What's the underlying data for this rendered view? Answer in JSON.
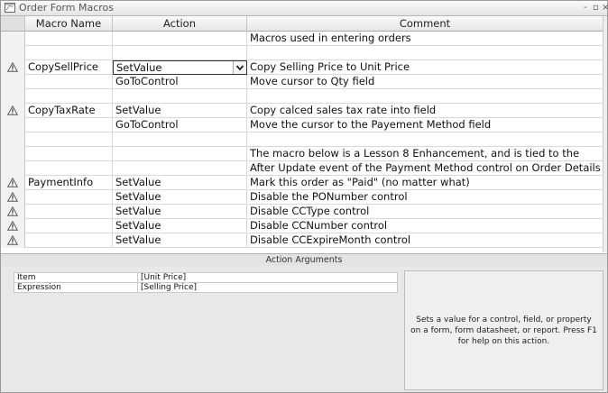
{
  "window": {
    "title": "Order Form Macros",
    "controls": {
      "minimize": "-",
      "restore": "▫",
      "close": "×"
    }
  },
  "columns": {
    "name": "Macro Name",
    "action": "Action",
    "comment": "Comment"
  },
  "rows": [
    {
      "warn": false,
      "name": "",
      "action": "",
      "comment": "Macros used in entering orders"
    },
    {
      "warn": false,
      "name": "",
      "action": "",
      "comment": ""
    },
    {
      "warn": true,
      "name": "CopySellPrice",
      "action": "SetValue",
      "comment": "Copy Selling Price to Unit Price"
    },
    {
      "warn": false,
      "name": "",
      "action": "GoToControl",
      "comment": "Move cursor to  Qty field"
    },
    {
      "warn": false,
      "name": "",
      "action": "",
      "comment": ""
    },
    {
      "warn": true,
      "name": "CopyTaxRate",
      "action": "SetValue",
      "comment": "Copy calced sales tax rate into field"
    },
    {
      "warn": false,
      "name": "",
      "action": "GoToControl",
      "comment": "Move the cursor to the Payement Method field"
    },
    {
      "warn": false,
      "name": "",
      "action": "",
      "comment": ""
    },
    {
      "warn": false,
      "name": "",
      "action": "",
      "comment": "The macro below is a Lesson 8 Enhancement, and is tied to the"
    },
    {
      "warn": false,
      "name": "",
      "action": "",
      "comment": "After Update event of the Payment Method control on Order Details Subf"
    },
    {
      "warn": true,
      "name": "PaymentInfo",
      "action": "SetValue",
      "comment": "Mark this order as \"Paid\" (no matter what)"
    },
    {
      "warn": true,
      "name": "",
      "action": "SetValue",
      "comment": "Disable the PONumber control"
    },
    {
      "warn": true,
      "name": "",
      "action": "SetValue",
      "comment": "Disable CCType control"
    },
    {
      "warn": true,
      "name": "",
      "action": "SetValue",
      "comment": "Disable CCNumber control"
    },
    {
      "warn": true,
      "name": "",
      "action": "SetValue",
      "comment": "Disable CCExpireMonth control"
    }
  ],
  "active_row": 2,
  "action_arguments": {
    "header": "Action Arguments",
    "items": [
      {
        "label": "Item",
        "value": "[Unit Price]"
      },
      {
        "label": "Expression",
        "value": "[Selling Price]"
      }
    ],
    "help_text": "Sets a value for a control, field, or property on a form, form datasheet, or report. Press F1 for help on this action."
  },
  "icons": {
    "title": "macro-icon",
    "warning": "warning-icon",
    "dropdown": "chevron-down-icon"
  }
}
